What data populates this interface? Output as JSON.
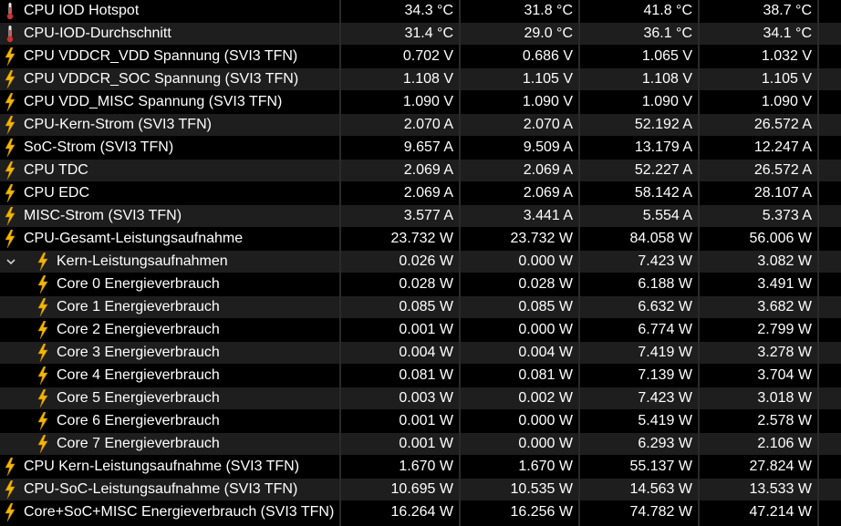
{
  "colors": {
    "background": "#000000",
    "row_alt": "#1e1e1e",
    "text": "#ffffff",
    "bolt": "#f2b705",
    "thermo": "#d9534f"
  },
  "rows": [
    {
      "label": "CPU IOD Hotspot",
      "icon": "thermometer-icon",
      "level": 0,
      "values": [
        "34.3 °C",
        "31.8 °C",
        "41.8 °C",
        "38.7 °C"
      ]
    },
    {
      "label": "CPU-IOD-Durchschnitt",
      "icon": "thermometer-icon",
      "level": 0,
      "values": [
        "31.4 °C",
        "29.0 °C",
        "36.1 °C",
        "34.1 °C"
      ]
    },
    {
      "label": "CPU VDDCR_VDD Spannung (SVI3 TFN)",
      "icon": "lightning-icon",
      "level": 0,
      "values": [
        "0.702 V",
        "0.686 V",
        "1.065 V",
        "1.032 V"
      ]
    },
    {
      "label": "CPU VDDCR_SOC Spannung (SVI3 TFN)",
      "icon": "lightning-icon",
      "level": 0,
      "values": [
        "1.108 V",
        "1.105 V",
        "1.108 V",
        "1.105 V"
      ]
    },
    {
      "label": "CPU VDD_MISC Spannung (SVI3 TFN)",
      "icon": "lightning-icon",
      "level": 0,
      "values": [
        "1.090 V",
        "1.090 V",
        "1.090 V",
        "1.090 V"
      ]
    },
    {
      "label": "CPU-Kern-Strom (SVI3 TFN)",
      "icon": "lightning-icon",
      "level": 0,
      "values": [
        "2.070 A",
        "2.070 A",
        "52.192 A",
        "26.572 A"
      ]
    },
    {
      "label": "SoC-Strom (SVI3 TFN)",
      "icon": "lightning-icon",
      "level": 0,
      "values": [
        "9.657 A",
        "9.509 A",
        "13.179 A",
        "12.247 A"
      ]
    },
    {
      "label": "CPU TDC",
      "icon": "lightning-icon",
      "level": 0,
      "values": [
        "2.069 A",
        "2.069 A",
        "52.227 A",
        "26.572 A"
      ]
    },
    {
      "label": "CPU EDC",
      "icon": "lightning-icon",
      "level": 0,
      "values": [
        "2.069 A",
        "2.069 A",
        "58.142 A",
        "28.107 A"
      ]
    },
    {
      "label": "MISC-Strom (SVI3 TFN)",
      "icon": "lightning-icon",
      "level": 0,
      "values": [
        "3.577 A",
        "3.441 A",
        "5.554 A",
        "5.373 A"
      ]
    },
    {
      "label": "CPU-Gesamt-Leistungsaufnahme",
      "icon": "lightning-icon",
      "level": 0,
      "values": [
        "23.732 W",
        "23.732 W",
        "84.058 W",
        "56.006 W"
      ]
    },
    {
      "label": "Kern-Leistungsaufnahmen",
      "icon": "lightning-icon",
      "level": 1,
      "expander": true,
      "values": [
        "0.026 W",
        "0.000 W",
        "7.423 W",
        "3.082 W"
      ]
    },
    {
      "label": "Core 0 Energieverbrauch",
      "icon": "lightning-icon",
      "level": 2,
      "values": [
        "0.028 W",
        "0.028 W",
        "6.188 W",
        "3.491 W"
      ]
    },
    {
      "label": "Core 1 Energieverbrauch",
      "icon": "lightning-icon",
      "level": 2,
      "values": [
        "0.085 W",
        "0.085 W",
        "6.632 W",
        "3.682 W"
      ]
    },
    {
      "label": "Core 2 Energieverbrauch",
      "icon": "lightning-icon",
      "level": 2,
      "values": [
        "0.001 W",
        "0.000 W",
        "6.774 W",
        "2.799 W"
      ]
    },
    {
      "label": "Core 3 Energieverbrauch",
      "icon": "lightning-icon",
      "level": 2,
      "values": [
        "0.004 W",
        "0.004 W",
        "7.419 W",
        "3.278 W"
      ]
    },
    {
      "label": "Core 4 Energieverbrauch",
      "icon": "lightning-icon",
      "level": 2,
      "values": [
        "0.081 W",
        "0.081 W",
        "7.139 W",
        "3.704 W"
      ]
    },
    {
      "label": "Core 5 Energieverbrauch",
      "icon": "lightning-icon",
      "level": 2,
      "values": [
        "0.003 W",
        "0.002 W",
        "7.423 W",
        "3.018 W"
      ]
    },
    {
      "label": "Core 6 Energieverbrauch",
      "icon": "lightning-icon",
      "level": 2,
      "values": [
        "0.001 W",
        "0.000 W",
        "5.419 W",
        "2.578 W"
      ]
    },
    {
      "label": "Core 7 Energieverbrauch",
      "icon": "lightning-icon",
      "level": 2,
      "values": [
        "0.001 W",
        "0.000 W",
        "6.293 W",
        "2.106 W"
      ]
    },
    {
      "label": "CPU Kern-Leistungsaufnahme (SVI3 TFN)",
      "icon": "lightning-icon",
      "level": 0,
      "values": [
        "1.670 W",
        "1.670 W",
        "55.137 W",
        "27.824 W"
      ]
    },
    {
      "label": "CPU-SoC-Leistungsaufnahme (SVI3 TFN)",
      "icon": "lightning-icon",
      "level": 0,
      "values": [
        "10.695 W",
        "10.535 W",
        "14.563 W",
        "13.533 W"
      ]
    },
    {
      "label": "Core+SoC+MISC Energieverbrauch (SVI3 TFN)",
      "icon": "lightning-icon",
      "level": 0,
      "values": [
        "16.264 W",
        "16.256 W",
        "74.782 W",
        "47.214 W"
      ]
    }
  ]
}
